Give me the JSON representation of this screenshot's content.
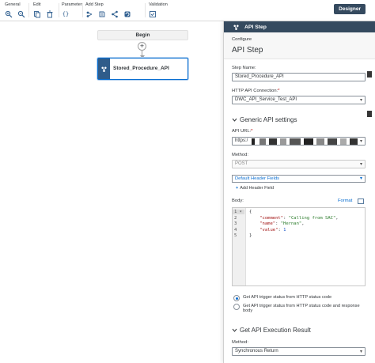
{
  "toolbar": {
    "groups": [
      {
        "label": "General",
        "icons": [
          "zoom-in-icon",
          "zoom-out-icon"
        ]
      },
      {
        "label": "Edit",
        "icons": [
          "copy-icon",
          "delete-icon"
        ]
      },
      {
        "label": "Parameter",
        "icons": [
          "braces-icon"
        ]
      },
      {
        "label": "Add Step",
        "icons": [
          "add-step-icon",
          "script-icon",
          "branch-icon",
          "loop-icon"
        ]
      },
      {
        "label": "Validation",
        "icons": [
          "validation-icon"
        ]
      }
    ],
    "designer_label": "Designer"
  },
  "canvas": {
    "begin_label": "Begin",
    "add_symbol": "+",
    "step_label": "Stored_Procedure_API"
  },
  "panel": {
    "header_title": "API Step",
    "configure_label": "Configure",
    "title": "API Step",
    "step_name_label": "Step Name:",
    "step_name_value": "Stored_Procedure_API",
    "connection_label": "HTTP API Connection:",
    "connection_value": "DWC_API_Service_Test_API",
    "generic_section": "Generic API settings",
    "api_url_label": "API URL:",
    "api_url_value": "https:/",
    "method_label": "Method:",
    "method_value": "POST",
    "header_fields_label": "Default Header Fields",
    "add_header_label": "Add Header Field",
    "body_label": "Body:",
    "format_label": "Format",
    "body_lines": [
      {
        "num": "1",
        "parts": [
          {
            "t": "{",
            "c": ""
          }
        ]
      },
      {
        "num": "2",
        "parts": [
          {
            "t": "    ",
            "c": ""
          },
          {
            "t": "\"comment\"",
            "c": "key"
          },
          {
            "t": ": ",
            "c": ""
          },
          {
            "t": "\"Calling from SAC\"",
            "c": "str"
          },
          {
            "t": ",",
            "c": ""
          }
        ]
      },
      {
        "num": "3",
        "parts": [
          {
            "t": "    ",
            "c": ""
          },
          {
            "t": "\"name\"",
            "c": "key"
          },
          {
            "t": ": ",
            "c": ""
          },
          {
            "t": "\"Hernan\"",
            "c": "str"
          },
          {
            "t": ",",
            "c": ""
          }
        ]
      },
      {
        "num": "4",
        "parts": [
          {
            "t": "    ",
            "c": ""
          },
          {
            "t": "\"value\"",
            "c": "key"
          },
          {
            "t": ": ",
            "c": ""
          },
          {
            "t": "1",
            "c": "num"
          }
        ]
      },
      {
        "num": "5",
        "parts": [
          {
            "t": "}",
            "c": ""
          }
        ]
      }
    ],
    "radio_option_1": "Get API trigger status from HTTP status code",
    "radio_option_2": "Get API trigger status from HTTP status code and response body",
    "execution_section": "Get API Execution Result",
    "exec_method_label": "Method:",
    "exec_method_value": "Synchronous Return"
  },
  "colors": {
    "header_bg": "#354a5f",
    "accent": "#0a6ed1",
    "node_icon_bg": "#2f5c8a"
  }
}
